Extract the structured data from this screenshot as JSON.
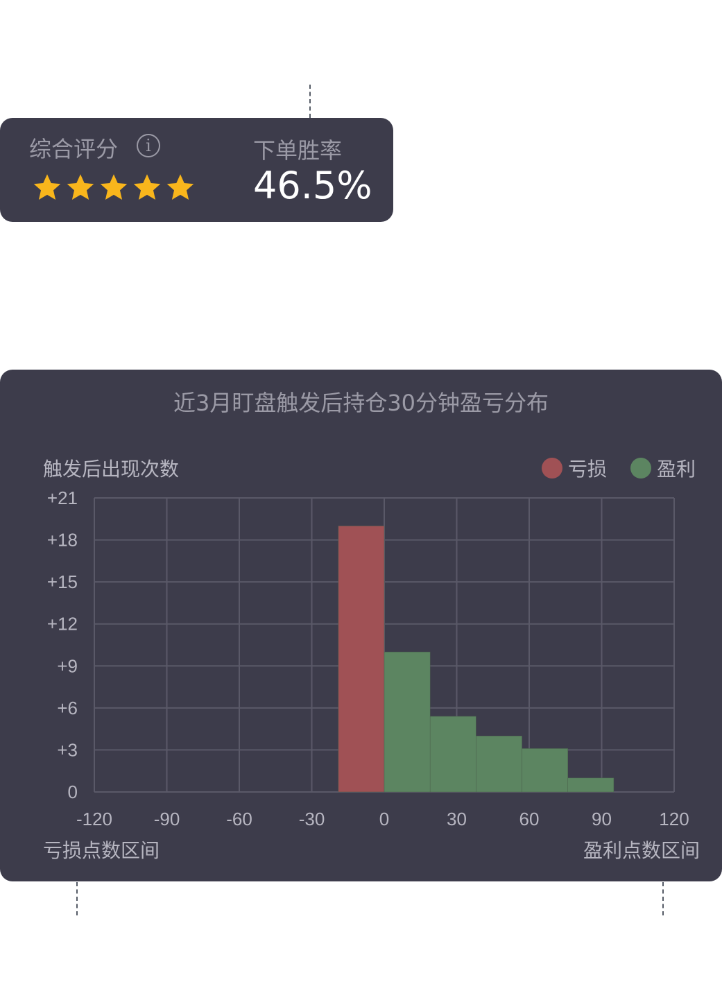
{
  "score_card": {
    "label": "综合评分",
    "info_icon_text": "i",
    "rating": 5,
    "rating_max": 5,
    "star_color": "#f9b61c",
    "winrate_label": "下单胜率",
    "winrate_value": "46.5%"
  },
  "chart_data": {
    "type": "bar",
    "title": "近3月盯盘触发后持仓30分钟盈亏分布",
    "ylabel": "触发后出现次数",
    "xlabel_left": "亏损点数区间",
    "xlabel_right": "盈利点数区间",
    "xlim": [
      -120,
      120
    ],
    "ylim": [
      0,
      21
    ],
    "x_ticks": [
      "-120",
      "-90",
      "-60",
      "-30",
      "0",
      "30",
      "60",
      "90",
      "120"
    ],
    "x_tick_values": [
      -120,
      -90,
      -60,
      -30,
      0,
      30,
      60,
      90,
      120
    ],
    "y_ticks": [
      "0",
      "+3",
      "+6",
      "+9",
      "+12",
      "+15",
      "+18",
      "+21"
    ],
    "y_tick_values": [
      0,
      3,
      6,
      9,
      12,
      15,
      18,
      21
    ],
    "grid": true,
    "legend_position": "top-right",
    "series": [
      {
        "name": "亏损",
        "color": "#a05155",
        "bars": [
          {
            "x0": -19,
            "x1": 0,
            "value": 19
          }
        ]
      },
      {
        "name": "盈利",
        "color": "#5c8561",
        "bars": [
          {
            "x0": 0,
            "x1": 19,
            "value": 10
          },
          {
            "x0": 19,
            "x1": 38,
            "value": 5.4
          },
          {
            "x0": 38,
            "x1": 57,
            "value": 4
          },
          {
            "x0": 57,
            "x1": 76,
            "value": 3.1
          },
          {
            "x0": 76,
            "x1": 95,
            "value": 1
          }
        ]
      }
    ]
  }
}
